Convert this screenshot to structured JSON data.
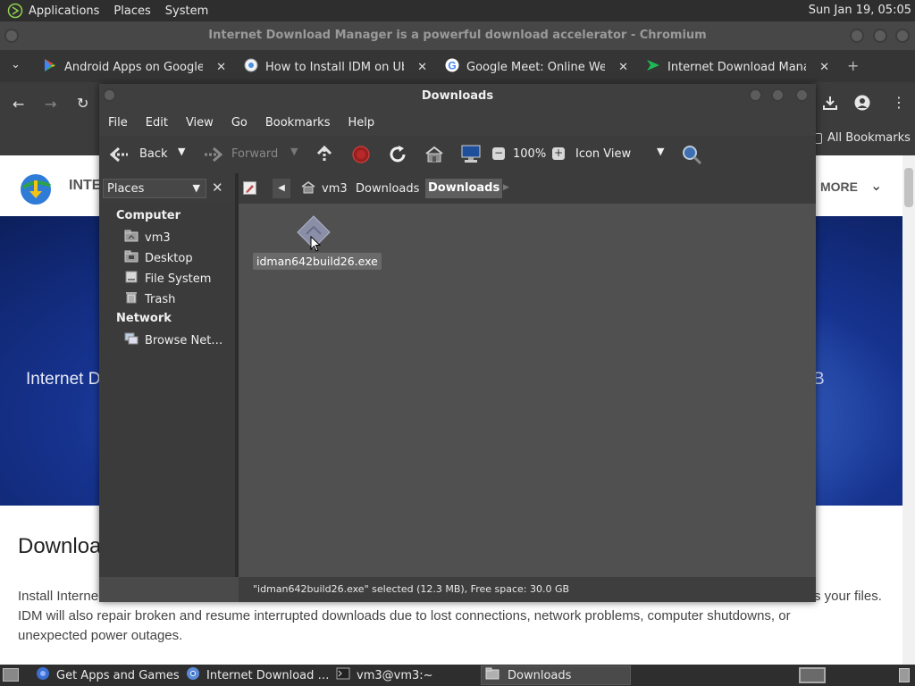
{
  "top_panel": {
    "menus": [
      "Applications",
      "Places",
      "System"
    ],
    "clock": "Sun Jan 19, 05:05"
  },
  "browser": {
    "title": "Internet Download Manager is a powerful download accelerator - Chromium",
    "tabs": [
      {
        "label": "Android Apps on Google Pl",
        "icon": "google-play-icon"
      },
      {
        "label": "How to Install IDM on Ubu",
        "icon": "globe-icon"
      },
      {
        "label": "Google Meet: Online Web",
        "icon": "google-icon"
      },
      {
        "label": "Internet Download Manag",
        "icon": "idm-icon"
      }
    ],
    "bookmarks_label": "All Bookmarks",
    "page": {
      "brand": "INTE",
      "more_label": "MORE",
      "hero_text": "Internet D",
      "hero_text_right": "B",
      "heading": "Downloa",
      "para_line1_left": "Install Interne",
      "para_line1_right": "s your files.",
      "para_line2": "IDM will also repair broken and resume interrupted downloads due to lost connections, network problems, computer shutdowns, or",
      "para_line3": "unexpected power outages."
    }
  },
  "file_manager": {
    "title": "Downloads",
    "menu": [
      "File",
      "Edit",
      "View",
      "Go",
      "Bookmarks",
      "Help"
    ],
    "toolbar": {
      "back": "Back",
      "forward": "Forward",
      "zoom": "100%",
      "view_mode": "Icon View"
    },
    "sidebar_selector": "Places",
    "path": [
      "vm3",
      "Downloads",
      "Downloads"
    ],
    "sidebar": {
      "computer_heading": "Computer",
      "computer_items": [
        {
          "label": "vm3",
          "icon": "home-folder-icon"
        },
        {
          "label": "Desktop",
          "icon": "desktop-folder-icon"
        },
        {
          "label": "File System",
          "icon": "drive-icon"
        },
        {
          "label": "Trash",
          "icon": "trash-icon"
        }
      ],
      "network_heading": "Network",
      "network_items": [
        {
          "label": "Browse Net…",
          "icon": "network-icon"
        }
      ]
    },
    "files": [
      {
        "name": "idman642build26.exe",
        "icon": "executable-icon",
        "selected": true
      }
    ],
    "status": "\"idman642build26.exe\" selected (12.3 MB), Free space: 30.0 GB"
  },
  "taskbar": {
    "items": [
      {
        "label": "Get Apps and Games",
        "icon": "store-icon"
      },
      {
        "label": "Internet Download …",
        "icon": "chromium-icon"
      },
      {
        "label": "vm3@vm3:~",
        "icon": "terminal-icon"
      },
      {
        "label": "Downloads",
        "icon": "folder-icon",
        "active": true
      }
    ]
  }
}
